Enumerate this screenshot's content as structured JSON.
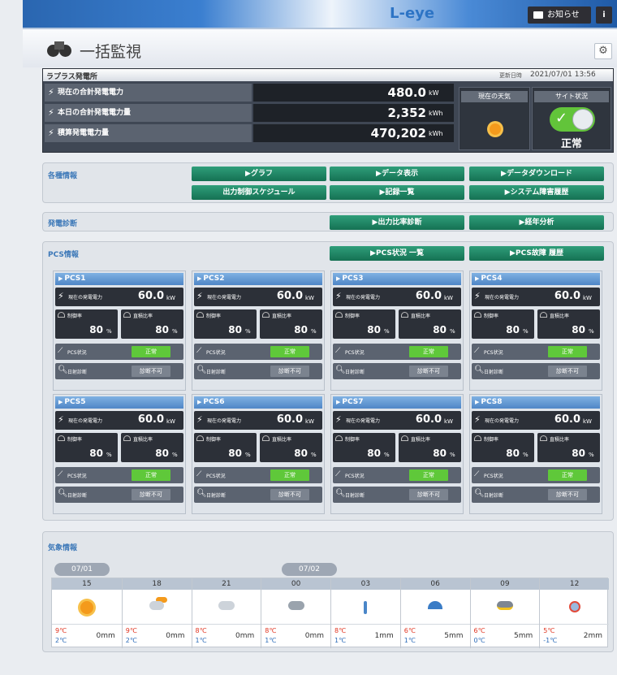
{
  "topbar": {
    "logo": "L-eye",
    "notice_label": "お知らせ",
    "info_label": "i"
  },
  "page": {
    "title": "一括監視"
  },
  "plant": {
    "name": "ラプラス発電所",
    "updated_label": "更新日時",
    "updated_value": "2021/07/01 13:56",
    "metrics": [
      {
        "label": "現在の合計発電電力",
        "value": "480.0",
        "unit": "kW"
      },
      {
        "label": "本日の合計発電電力量",
        "value": "2,352",
        "unit": "kWh"
      },
      {
        "label": "積算発電電力量",
        "value": "470,202",
        "unit": "kWh"
      }
    ],
    "weather_label": "現在の天気",
    "site_label": "サイト状況",
    "site_status": "正常"
  },
  "kaku": {
    "title": "各種情報",
    "buttons": [
      "▶グラフ",
      "▶データ表示",
      "▶データダウンロード",
      "出力制御スケジュール",
      "▶記録一覧",
      "▶システム障害履歴"
    ]
  },
  "diag": {
    "title": "発電診断",
    "buttons": [
      "▶出力比率診断",
      "▶経年分析"
    ]
  },
  "pcsinfo": {
    "title": "PCS情報",
    "buttons": [
      "▶PCS状況 一覧",
      "▶PCS故障 履歴"
    ],
    "power_label": "現在の発電電力",
    "ctrl_label": "制御率",
    "ratio_label": "直積比率",
    "status_label": "PCS状況",
    "diag_label": "日射診断",
    "units": [
      {
        "name": "PCS1",
        "power": "60.0",
        "unit": "kW",
        "ctrl": "80",
        "ratio": "80",
        "pct": "%",
        "status": "正常",
        "diag": "診断不可"
      },
      {
        "name": "PCS2",
        "power": "60.0",
        "unit": "kW",
        "ctrl": "80",
        "ratio": "80",
        "pct": "%",
        "status": "正常",
        "diag": "診断不可"
      },
      {
        "name": "PCS3",
        "power": "60.0",
        "unit": "kW",
        "ctrl": "80",
        "ratio": "80",
        "pct": "%",
        "status": "正常",
        "diag": "診断不可"
      },
      {
        "name": "PCS4",
        "power": "60.0",
        "unit": "kW",
        "ctrl": "80",
        "ratio": "80",
        "pct": "%",
        "status": "正常",
        "diag": "診断不可"
      },
      {
        "name": "PCS5",
        "power": "60.0",
        "unit": "kW",
        "ctrl": "80",
        "ratio": "80",
        "pct": "%",
        "status": "正常",
        "diag": "診断不可"
      },
      {
        "name": "PCS6",
        "power": "60.0",
        "unit": "kW",
        "ctrl": "80",
        "ratio": "80",
        "pct": "%",
        "status": "正常",
        "diag": "診断不可"
      },
      {
        "name": "PCS7",
        "power": "60.0",
        "unit": "kW",
        "ctrl": "80",
        "ratio": "80",
        "pct": "%",
        "status": "正常",
        "diag": "診断不可"
      },
      {
        "name": "PCS8",
        "power": "60.0",
        "unit": "kW",
        "ctrl": "80",
        "ratio": "80",
        "pct": "%",
        "status": "正常",
        "diag": "診断不可"
      }
    ]
  },
  "weather": {
    "title": "気象情報",
    "dates": [
      "07/01",
      "07/02"
    ],
    "hours": [
      {
        "time": "15",
        "icon": "sun-icon",
        "hi": "9℃",
        "lo": "2℃",
        "rain": "0mm"
      },
      {
        "time": "18",
        "icon": "partly-cloudy-icon",
        "hi": "9℃",
        "lo": "2℃",
        "rain": "0mm"
      },
      {
        "time": "21",
        "icon": "cloud-icon",
        "hi": "8℃",
        "lo": "1℃",
        "rain": "0mm"
      },
      {
        "time": "00",
        "icon": "cloud-moon-icon",
        "hi": "8℃",
        "lo": "1℃",
        "rain": "0mm"
      },
      {
        "time": "03",
        "icon": "rain-icon",
        "hi": "8℃",
        "lo": "1℃",
        "rain": "1mm"
      },
      {
        "time": "06",
        "icon": "umbrella-icon",
        "hi": "6℃",
        "lo": "1℃",
        "rain": "5mm"
      },
      {
        "time": "09",
        "icon": "thunder-icon",
        "hi": "6℃",
        "lo": "0℃",
        "rain": "5mm"
      },
      {
        "time": "12",
        "icon": "snow-icon",
        "hi": "5℃",
        "lo": "-1℃",
        "rain": "2mm"
      }
    ]
  }
}
